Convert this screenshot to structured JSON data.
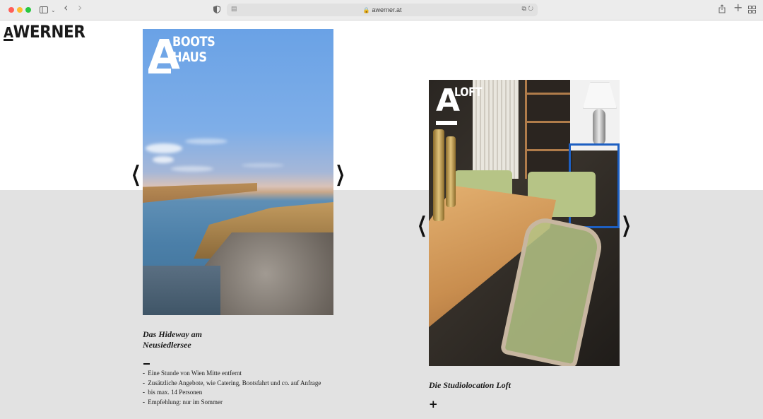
{
  "browser": {
    "url": "awerner.at",
    "icons": {
      "sidebar": "sidebar-icon",
      "back": "‹",
      "forward": "›",
      "shield": "shield-icon",
      "share": "share-icon",
      "new_tab": "+",
      "tab_overview": "grid-icon"
    }
  },
  "site": {
    "logo_letter": "A",
    "logo_text": "WERNER"
  },
  "cards": [
    {
      "badge_letter": "A",
      "badge_text_line1": "BOOTS",
      "badge_text_line2": "HAUS",
      "title_line1": "Das Hideway am",
      "title_line2": "Neusiedlersee",
      "features": [
        "Eine Stunde von Wien Mitte entfernt",
        "Zusätzliche Angebote, wie Catering, Bootsfahrt und co. auf Anfrage",
        "bis max. 14 Personen",
        "Empfehlung: nur im Sommer"
      ]
    },
    {
      "badge_letter": "A",
      "badge_text_line1": "LOFT",
      "title_line1": "Die Studiolocation Loft",
      "toggle": "+"
    }
  ],
  "arrows": {
    "prev": "❮",
    "next": "❯"
  }
}
